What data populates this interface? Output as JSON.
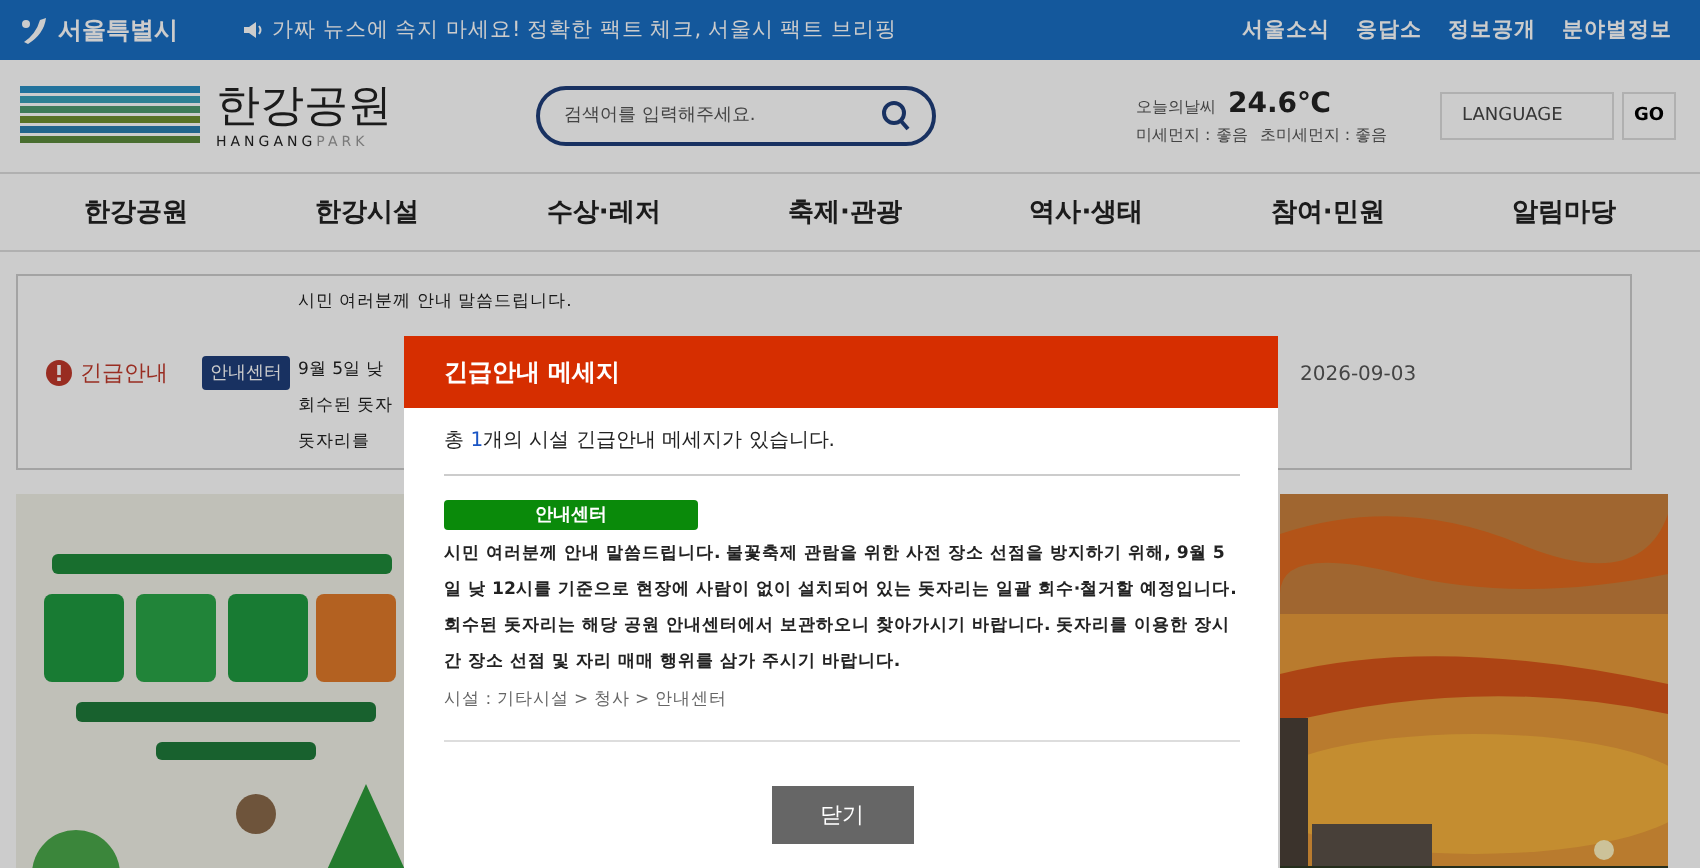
{
  "top_bar": {
    "brand": "서울특별시",
    "ticker": "가짜 뉴스에 속지 마세요! 정확한 팩트 체크, 서울시 팩트 브리핑",
    "links": [
      "서울소식",
      "응답소",
      "정보공개",
      "분야별정보"
    ]
  },
  "header": {
    "logo_title": "한강공원",
    "logo_sub_main": "HANGANG",
    "logo_sub_accent": "PARK",
    "search": {
      "placeholder": "검색어를 입력해주세요."
    },
    "weather": {
      "label": "오늘의날씨",
      "temperature": "24.6℃",
      "dust": "미세먼지 : 좋음",
      "fine_dust": "초미세먼지 : 좋음"
    },
    "language": {
      "placeholder": "LANGUAGE",
      "button": "GO"
    }
  },
  "nav": [
    "한강공원",
    "한강시설",
    "수상·레저",
    "축제·관광",
    "역사·생태",
    "참여·민원",
    "알림마당"
  ],
  "notice": {
    "label": "긴급안내",
    "badge": "안내센터",
    "lines": [
      "시민 여러분께 안내 말씀드립니다.",
      "9월 5일 낮",
      "회수된 돗자",
      "돗자리를"
    ],
    "date": "2026-09-03"
  },
  "modal": {
    "title": "긴급안내 메세지",
    "summary_prefix": "총 ",
    "summary_count": "1",
    "summary_suffix": "개의 시설 긴급안내 메세지가 있습니다.",
    "badge": "안내센터",
    "message": "시민 여러분께 안내 말씀드립니다. 불꽃축제 관람을 위한 사전 장소 선점을 방지하기 위해, 9월 5일 낮 12시를 기준으로 현장에 사람이 없이 설치되어 있는 돗자리는 일괄 회수·철거할 예정입니다. 회수된 돗자리는 해당 공원 안내센터에서 보관하오니 찾아가시기 바랍니다. 돗자리를 이용한 장시간 장소 선점 및 자리 매매 행위를 삼가 주시기 바랍니다.",
    "path": "시설 : 기타시설 > 청사 > 안내센터",
    "close": "닫기"
  }
}
